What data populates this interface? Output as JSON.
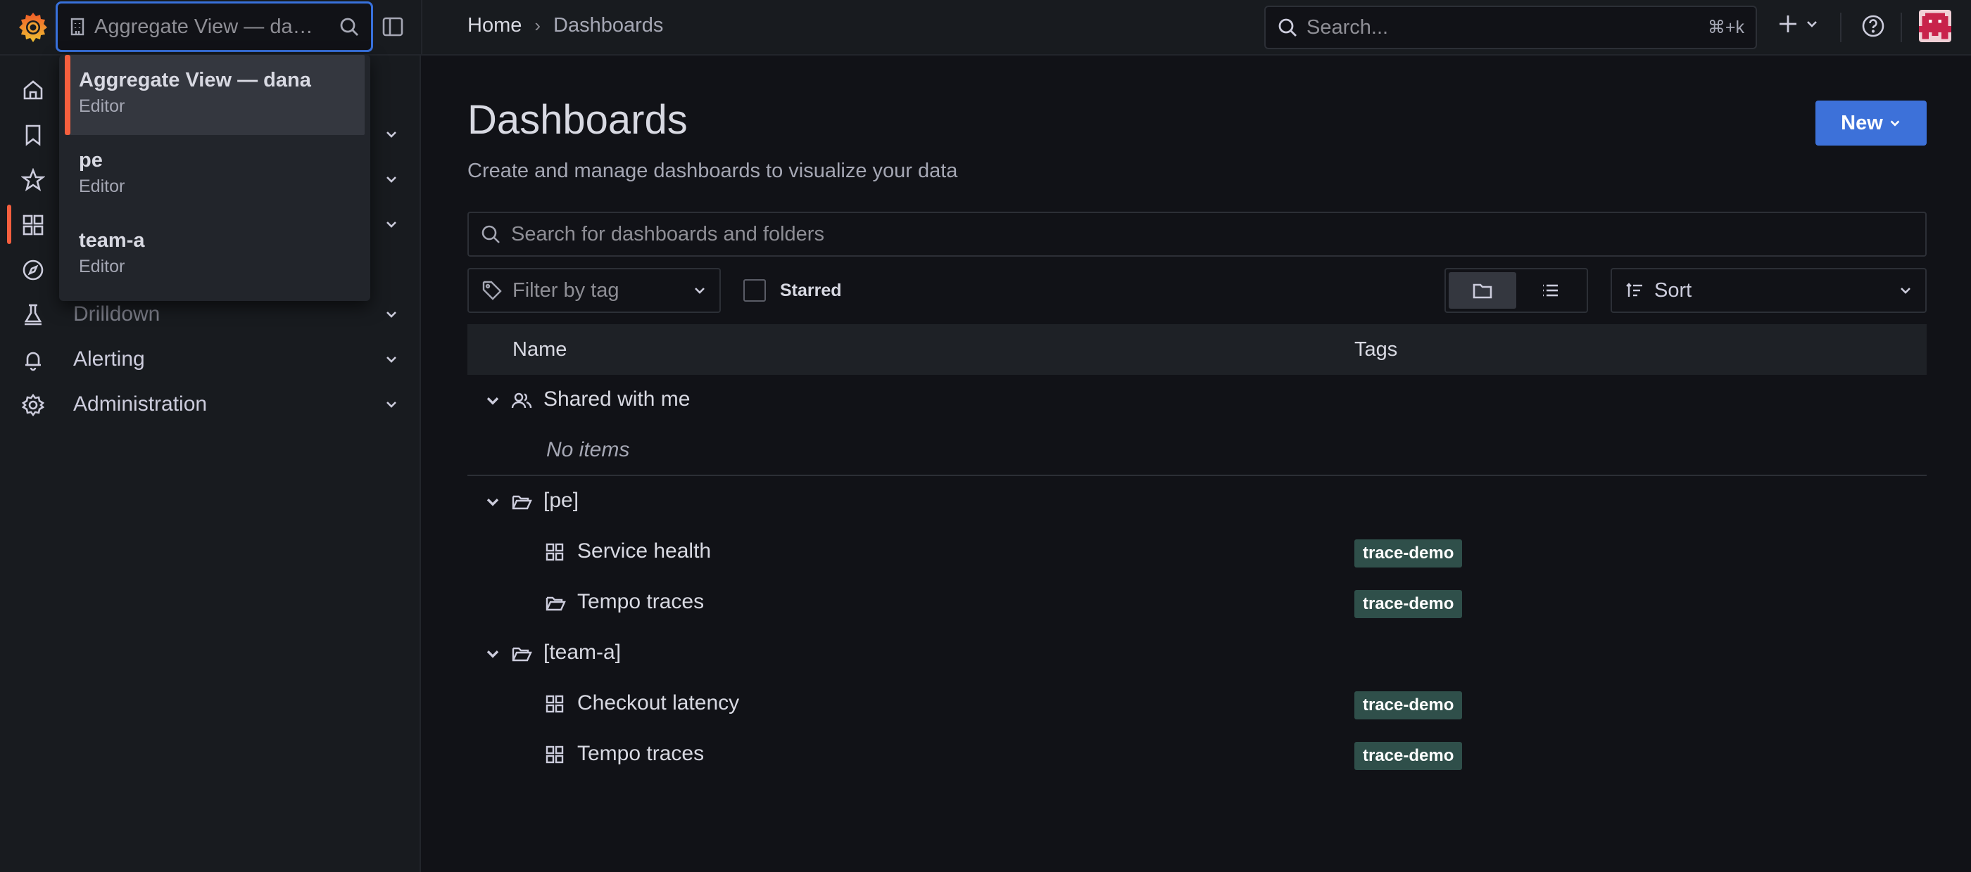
{
  "topbar": {
    "org_switcher_value": "Aggregate View — da…",
    "breadcrumb_home": "Home",
    "breadcrumb_current": "Dashboards",
    "search_placeholder": "Search...",
    "search_shortcut": "⌘+k"
  },
  "org_dropdown": {
    "options": [
      {
        "name": "Aggregate View — dana",
        "role": "Editor",
        "selected": true
      },
      {
        "name": "pe",
        "role": "Editor",
        "selected": false
      },
      {
        "name": "team-a",
        "role": "Editor",
        "selected": false
      }
    ]
  },
  "sidebar": {
    "items": [
      {
        "label": "Home",
        "icon": "home-icon"
      },
      {
        "label": "Bookmarks",
        "icon": "bookmark-icon"
      },
      {
        "label": "Starred",
        "icon": "star-icon"
      },
      {
        "label": "Dashboards",
        "icon": "dashboards-icon",
        "active": true
      },
      {
        "label": "Explore",
        "icon": "compass-icon"
      },
      {
        "label": "Drilldown",
        "icon": "drilldown-icon"
      },
      {
        "label": "Alerting",
        "icon": "bell-icon"
      },
      {
        "label": "Administration",
        "icon": "gear-icon"
      }
    ]
  },
  "page": {
    "title": "Dashboards",
    "subtitle": "Create and manage dashboards to visualize your data",
    "new_button": "New",
    "search_placeholder": "Search for dashboards and folders",
    "tag_filter_placeholder": "Filter by tag",
    "starred_label": "Starred",
    "sort_label": "Sort"
  },
  "table": {
    "col_name": "Name",
    "col_tags": "Tags",
    "shared_folder": "Shared with me",
    "no_items": "No items",
    "folder_pe": "[pe]",
    "pe_item1": "Service health",
    "pe_item2": "Tempo traces",
    "folder_team": "[team-a]",
    "team_item1": "Checkout latency",
    "team_item2": "Tempo traces",
    "tag": "trace-demo"
  },
  "colors": {
    "accent_orange": "#f55f3e",
    "primary_blue": "#3d71d9",
    "tag_bg": "#2f4f4a"
  }
}
